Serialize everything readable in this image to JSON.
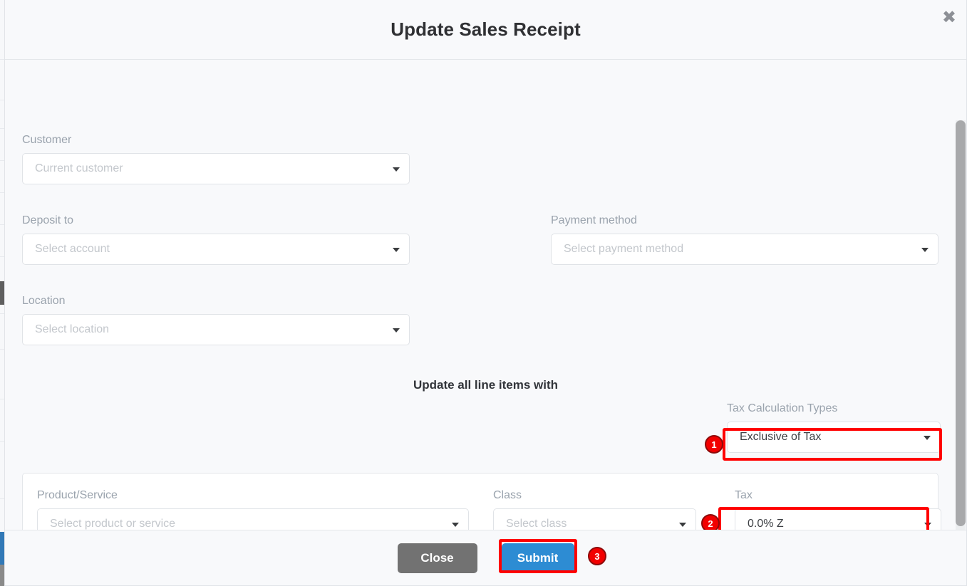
{
  "modal": {
    "title": "Update Sales Receipt",
    "close_icon": "close-icon",
    "close_glyph": "✖"
  },
  "form": {
    "customer": {
      "label": "Customer",
      "placeholder": "Current customer",
      "value": ""
    },
    "deposit_to": {
      "label": "Deposit to",
      "placeholder": "Select account",
      "value": ""
    },
    "payment_method": {
      "label": "Payment method",
      "placeholder": "Select payment method",
      "value": ""
    },
    "location": {
      "label": "Location",
      "placeholder": "Select location",
      "value": ""
    }
  },
  "section": {
    "heading": "Update all line items with",
    "tax_calculation": {
      "label": "Tax Calculation Types",
      "value": "Exclusive of Tax"
    }
  },
  "line_item": {
    "product_service": {
      "label": "Product/Service",
      "placeholder": "Select product or service",
      "value": ""
    },
    "class": {
      "label": "Class",
      "placeholder": "Select class",
      "value": ""
    },
    "tax": {
      "label": "Tax",
      "value": "0.0% Z"
    }
  },
  "footer": {
    "close_label": "Close",
    "submit_label": "Submit"
  },
  "annotations": {
    "badge_1": "1",
    "badge_2": "2",
    "badge_3": "3"
  },
  "colors": {
    "highlight": "#ff0000",
    "badge_fill": "#f20000",
    "badge_border": "#8d0b0b",
    "submit": "#2d8cd3",
    "close": "#727272",
    "modal_bg": "#f8f9fb",
    "label_text": "#9aa3ad",
    "placeholder_text": "#c3c7cc"
  }
}
